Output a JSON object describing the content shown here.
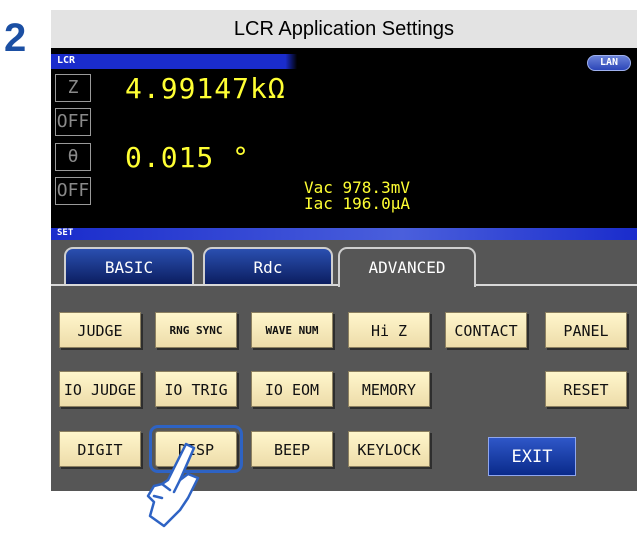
{
  "step_number": "2",
  "window": {
    "title": "LCR Application Settings"
  },
  "header": {
    "mode_label": "LCR",
    "lan_badge": "LAN"
  },
  "params": [
    {
      "label": "Z",
      "value": "4.99147kΩ"
    },
    {
      "label": "OFF"
    },
    {
      "label": "θ",
      "value": "0.015 °"
    },
    {
      "label": "OFF"
    }
  ],
  "monitor": {
    "vac": "Vac  978.3mV",
    "iac": "Iac  196.0μA"
  },
  "set_label": "SET",
  "tabs": [
    {
      "label": "BASIC",
      "active": false
    },
    {
      "label": "Rdc",
      "active": false
    },
    {
      "label": "ADVANCED",
      "active": true
    }
  ],
  "buttons": {
    "row1": [
      "JUDGE",
      "RNG SYNC",
      "WAVE NUM",
      "Hi Z",
      "CONTACT",
      "PANEL"
    ],
    "row2": [
      "IO JUDGE",
      "IO TRIG",
      "IO EOM",
      "MEMORY",
      "RESET"
    ],
    "row3": [
      "DIGIT",
      "DISP",
      "BEEP",
      "KEYLOCK"
    ]
  },
  "exit_label": "EXIT",
  "selected_button": "DISP",
  "colors": {
    "accent_blue": "#1a2ccc",
    "measurement_yellow": "#ffff33",
    "button_bg": "#f5e9bf",
    "selection_outline": "#2e63c4"
  }
}
